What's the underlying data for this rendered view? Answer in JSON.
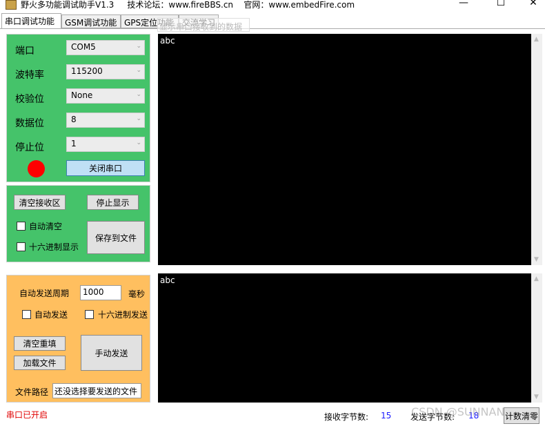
{
  "window": {
    "title": "野火多功能调试助手V1.3",
    "forum": "技术论坛：www.fireBBS.cn",
    "website": "官网：www.embedFire.com",
    "minimize": "—",
    "maximize": "☐",
    "close": "✕"
  },
  "tabs": [
    {
      "label": "串口调试功能"
    },
    {
      "label": "GSM调试功能"
    },
    {
      "label": "GPS定位功能"
    },
    {
      "label": "交流学习"
    }
  ],
  "tooltip": "显示串口接收到的数据",
  "serial": {
    "port_label": "端口",
    "port_value": "COM5",
    "baud_label": "波特率",
    "baud_value": "115200",
    "parity_label": "校验位",
    "parity_value": "None",
    "databits_label": "数据位",
    "databits_value": "8",
    "stopbits_label": "停止位",
    "stopbits_value": "1",
    "status_color": "#ff0000",
    "close_port": "关闭串口"
  },
  "receive_options": {
    "clear": "清空接收区",
    "stop_display": "停止显示",
    "auto_clear": "自动清空",
    "hex_display": "十六进制显示",
    "save_file": "保存到文件"
  },
  "send_options": {
    "period_label": "自动发送周期",
    "period_value": "1000",
    "period_unit": "毫秒",
    "auto_send": "自动发送",
    "hex_send": "十六进制发送",
    "clear_refill": "清空重填",
    "load_file": "加载文件",
    "manual_send": "手动发送",
    "path_label": "文件路径",
    "path_value": "还没选择要发送的文件"
  },
  "receive_area": {
    "text": "abc"
  },
  "send_area": {
    "text": "abc"
  },
  "status": {
    "port_status": "串口已开启",
    "rx_label": "接收字节数:",
    "rx_value": "15",
    "tx_label": "发送字节数:",
    "tx_value": "18",
    "reset_count": "计数清零"
  },
  "watermark": "CSDN @SUNNANL_66"
}
